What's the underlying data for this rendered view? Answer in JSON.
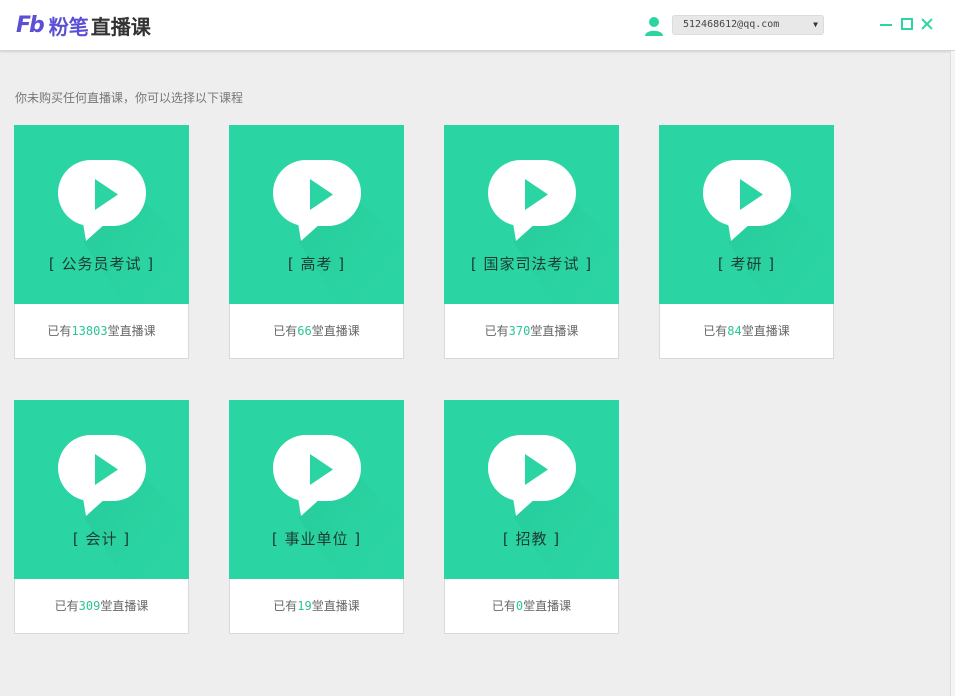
{
  "app": {
    "logo_mark": "Fb",
    "logo_brand": "粉笔",
    "logo_product": "直播课"
  },
  "account": {
    "email": "512468612@qq.com",
    "icon": "user-icon"
  },
  "window_controls": [
    "minimize-icon",
    "maximize-icon",
    "close-icon"
  ],
  "colors": {
    "accent": "#2bd5a3",
    "brand": "#5b4fd6",
    "count": "#2bc597"
  },
  "notice": "你未购买任何直播课，你可以选择以下课程",
  "courses": [
    {
      "title": "[ 公务员考试 ]",
      "prefix": "已有",
      "count": "13803",
      "suffix": "堂直播课"
    },
    {
      "title": "[ 高考 ]",
      "prefix": "已有",
      "count": "66",
      "suffix": "堂直播课"
    },
    {
      "title": "[ 国家司法考试 ]",
      "prefix": "已有",
      "count": "370",
      "suffix": "堂直播课"
    },
    {
      "title": "[ 考研 ]",
      "prefix": "已有",
      "count": "84",
      "suffix": "堂直播课"
    },
    {
      "title": "[ 会计 ]",
      "prefix": "已有",
      "count": "309",
      "suffix": "堂直播课"
    },
    {
      "title": "[ 事业单位 ]",
      "prefix": "已有",
      "count": "19",
      "suffix": "堂直播课"
    },
    {
      "title": "[ 招教 ]",
      "prefix": "已有",
      "count": "0",
      "suffix": "堂直播课"
    }
  ]
}
